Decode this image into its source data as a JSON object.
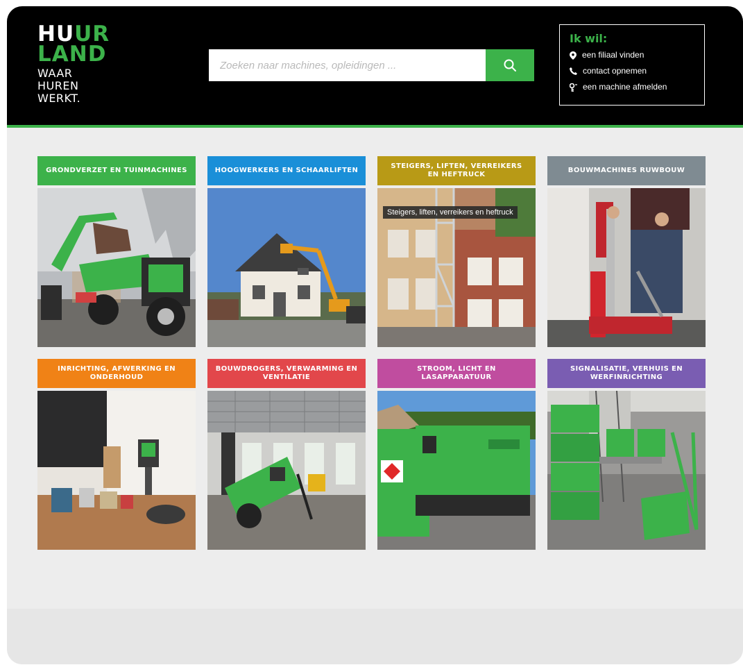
{
  "logo": {
    "line1": {
      "a": "HU",
      "b": "UR"
    },
    "line2": "LAND",
    "tagline": [
      "WAAR",
      "HUREN",
      "WERKT."
    ]
  },
  "search": {
    "placeholder": "Zoeken naar machines, opleidingen ...",
    "icon": "search-icon"
  },
  "ik_wil": {
    "title": "Ik wil:",
    "links": [
      {
        "label": "een filiaal vinden",
        "icon": "map-pin-icon"
      },
      {
        "label": "contact opnemen",
        "icon": "phone-icon"
      },
      {
        "label": "een machine afmelden",
        "icon": "key-icon"
      }
    ]
  },
  "categories": [
    {
      "label": "GRONDVERZET EN TUINMACHINES",
      "color": "#3cb24a"
    },
    {
      "label": "HOOGWERKERS EN SCHAARLIFTEN",
      "color": "#1a8fd8"
    },
    {
      "label": "STEIGERS, LIFTEN, VERREIKERS EN HEFTRUCK",
      "color": "#b89a16",
      "tooltip": "Steigers, liften, verreikers en heftruck"
    },
    {
      "label": "BOUWMACHINES RUWBOUW",
      "color": "#7f8b92"
    },
    {
      "label": "INRICHTING, AFWERKING EN ONDERHOUD",
      "color": "#f08216"
    },
    {
      "label": "BOUWDROGERS, VERWARMING EN VENTILATIE",
      "color": "#e2474b"
    },
    {
      "label": "STROOM, LICHT EN LASAPPARATUUR",
      "color": "#c04d9f"
    },
    {
      "label": "SIGNALISATIE, VERHUIS EN WERFINRICHTING",
      "color": "#7a5db2"
    }
  ],
  "colors": {
    "brand_green": "#3cb24a",
    "header_bg": "#000000",
    "page_bg": "#ededed"
  }
}
